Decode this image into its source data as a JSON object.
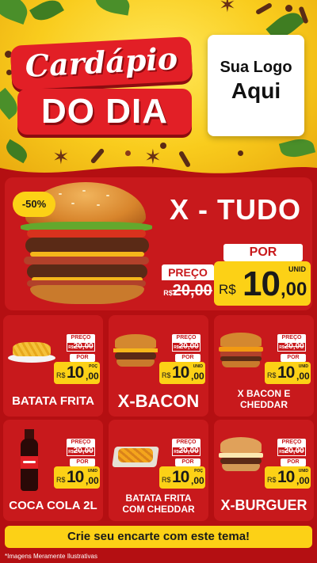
{
  "header": {
    "title_line1": "Cardápio",
    "title_line2": "DO DIA",
    "logo_line1": "Sua Logo",
    "logo_line2": "Aqui"
  },
  "hero": {
    "discount": "-50%",
    "title": "X - TUDO",
    "preco_label": "PREÇO",
    "old_rs": "R$",
    "old_price": "20,00",
    "por_label": "POR",
    "currency": "R$",
    "price_int": "10",
    "price_cents": ",00",
    "unit": "UNID"
  },
  "cards": [
    {
      "name": "BATATA FRITA",
      "preco_label": "PREÇO",
      "old_rs": "R$",
      "old_price": "20,00",
      "por_label": "POR",
      "currency": "R$",
      "price_int": "10",
      "price_cents": ",00",
      "unit": "POÇ"
    },
    {
      "name": "X-BACON",
      "preco_label": "PREÇO",
      "old_rs": "R$",
      "old_price": "20,00",
      "por_label": "POR",
      "currency": "R$",
      "price_int": "10",
      "price_cents": ",00",
      "unit": "UNID"
    },
    {
      "name": "X BACON E CHEDDAR",
      "preco_label": "PREÇO",
      "old_rs": "R$",
      "old_price": "20,00",
      "por_label": "POR",
      "currency": "R$",
      "price_int": "10",
      "price_cents": ",00",
      "unit": "UNID"
    },
    {
      "name": "COCA COLA 2L",
      "preco_label": "PREÇO",
      "old_rs": "R$",
      "old_price": "20,00",
      "por_label": "POR",
      "currency": "R$",
      "price_int": "10",
      "price_cents": ",00",
      "unit": "UNID"
    },
    {
      "name": "BATATA FRITA COM CHEDDAR",
      "preco_label": "PREÇO",
      "old_rs": "R$",
      "old_price": "20,00",
      "por_label": "POR",
      "currency": "R$",
      "price_int": "10",
      "price_cents": ",00",
      "unit": "POÇ"
    },
    {
      "name": "X-BURGUER",
      "preco_label": "PREÇO",
      "old_rs": "R$",
      "old_price": "20,00",
      "por_label": "POR",
      "currency": "R$",
      "price_int": "10",
      "price_cents": ",00",
      "unit": "UNID"
    }
  ],
  "cta": "Crie seu encarte com este tema!",
  "footnote": "*Imagens Meramente Ilustrativas",
  "colors": {
    "brand_red": "#c8191c",
    "title_red": "#e21f26",
    "accent_yellow": "#fcd116",
    "background": "#b40f12"
  }
}
